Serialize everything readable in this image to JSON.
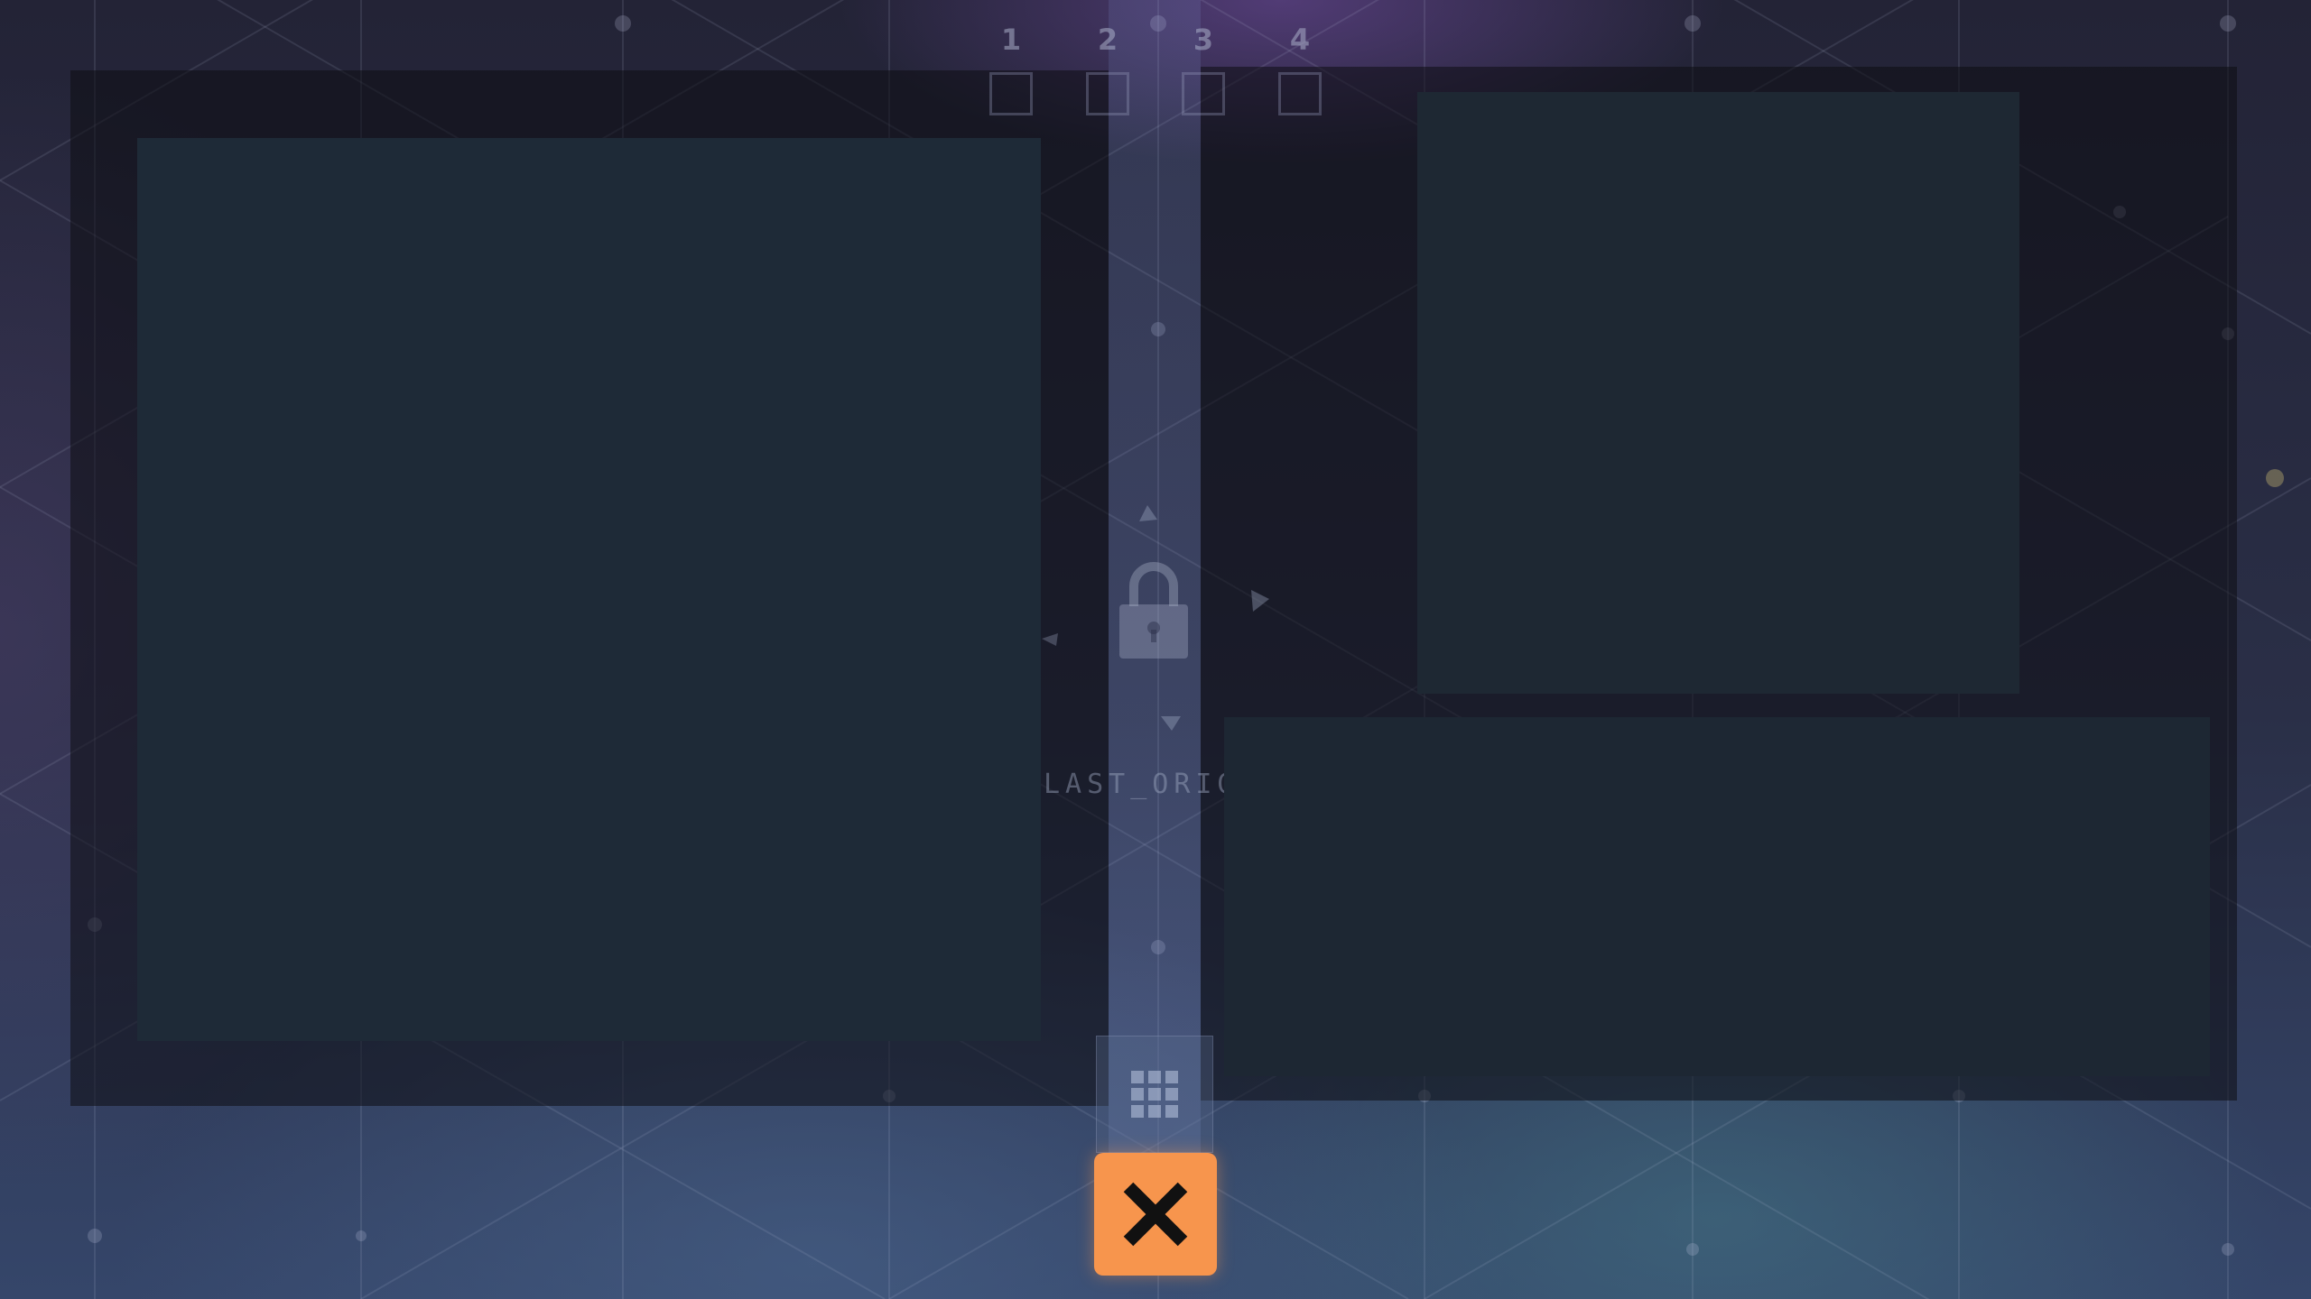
{
  "workspaces": [
    {
      "number": "1"
    },
    {
      "number": "2"
    },
    {
      "number": "3"
    },
    {
      "number": "4"
    }
  ],
  "center_panel": {
    "label": "LAST_ORIG"
  },
  "icons": {
    "lock": "lock-icon",
    "grid": "grid-icon",
    "close": "close-icon",
    "arrows": "arrow-icon"
  },
  "colors": {
    "accent": "#f7954d",
    "window": "#1e2936",
    "background": "#2a2f47"
  }
}
